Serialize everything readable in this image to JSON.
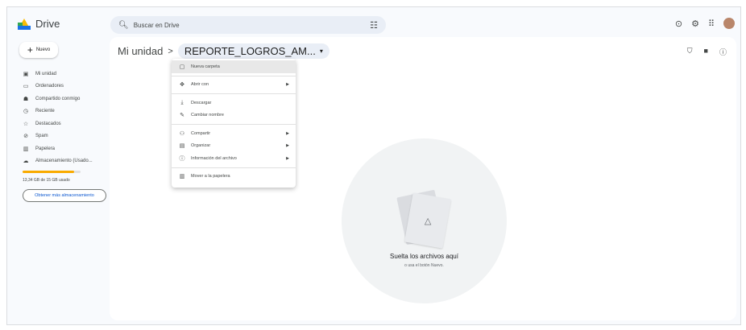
{
  "app": {
    "name": "Drive"
  },
  "search": {
    "placeholder": "Buscar en Drive"
  },
  "sidebar": {
    "new_label": "Nuevo",
    "items": [
      {
        "label": "Mi unidad",
        "icon": "my-drive-icon"
      },
      {
        "label": "Ordenadores",
        "icon": "computer-icon"
      },
      {
        "label": "Compartido conmigo",
        "icon": "shared-icon"
      },
      {
        "label": "Reciente",
        "icon": "clock-icon"
      },
      {
        "label": "Destacados",
        "icon": "star-icon"
      },
      {
        "label": "Spam",
        "icon": "spam-icon"
      },
      {
        "label": "Papelera",
        "icon": "trash-icon"
      },
      {
        "label": "Almacenamiento (Usado...",
        "icon": "cloud-icon"
      }
    ],
    "storage_text": "13,34 GB de 15 GB usado",
    "storage_fraction": 0.89,
    "more_storage_label": "Obtener más almacenamiento"
  },
  "breadcrumb": {
    "root": "Mi unidad",
    "separator": ">",
    "current": "REPORTE_LOGROS_AM..."
  },
  "context_menu": {
    "items": [
      {
        "label": "Nueva carpeta",
        "icon": "new-folder-icon",
        "highlight": true
      },
      {
        "label": "Abrir con",
        "icon": "open-with-icon",
        "submenu": true
      },
      {
        "label": "Descargar",
        "icon": "download-icon"
      },
      {
        "label": "Cambiar nombre",
        "icon": "rename-icon"
      },
      {
        "label": "Compartir",
        "icon": "share-icon",
        "submenu": true
      },
      {
        "label": "Organizar",
        "icon": "organize-icon",
        "submenu": true
      },
      {
        "label": "Información del archivo",
        "icon": "info-icon",
        "submenu": true
      },
      {
        "label": "Mover a la papelera",
        "icon": "trash-icon"
      }
    ]
  },
  "empty_state": {
    "title": "Suelta los archivos aquí",
    "subtitle": "o usa el botón Nuevo."
  },
  "colors": {
    "accent": "#0b57d0",
    "storage": "#f9ab00",
    "search_bg": "#e9eef6",
    "frame_bg": "#f8fafd"
  }
}
